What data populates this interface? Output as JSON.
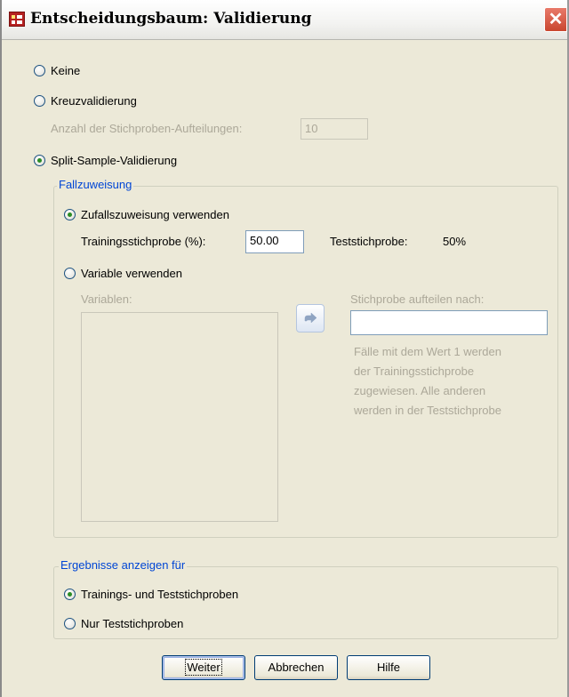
{
  "window": {
    "title": "Entscheidungsbaum: Validierung",
    "icon": "table-icon",
    "close_glyph": "✕"
  },
  "validation": {
    "options": [
      {
        "label": "Keine",
        "selected": false
      },
      {
        "label": "Kreuzvalidierung",
        "selected": false
      },
      {
        "label": "Split-Sample-Validierung",
        "selected": true
      }
    ],
    "folds_label": "Anzahl der Stichproben-Aufteilungen:",
    "folds_value": "10"
  },
  "case_assignment": {
    "group_title": "Fallzuweisung",
    "random_option": {
      "label": "Zufallszuweisung verwenden",
      "selected": true
    },
    "training_label": "Trainingsstichprobe (%):",
    "training_value": "50.00",
    "test_label": "Teststichprobe:",
    "test_value": "50%",
    "variable_option": {
      "label": "Variable verwenden",
      "selected": false
    },
    "variables_label": "Variablen:",
    "variables_list": [],
    "split_by_label": "Stichprobe aufteilen nach:",
    "split_by_value": "",
    "help_text": [
      "Fälle mit dem Wert 1 werden",
      "der Trainingsstichprobe",
      "zugewiesen. Alle anderen",
      "werden in der Teststichprobe"
    ]
  },
  "results": {
    "group_title": "Ergebnisse anzeigen für",
    "options": [
      {
        "label": "Trainings- und Teststichproben",
        "selected": true
      },
      {
        "label": "Nur Teststichproben",
        "selected": false
      }
    ]
  },
  "buttons": {
    "continue": "Weiter",
    "cancel": "Abbrechen",
    "help": "Hilfe"
  }
}
